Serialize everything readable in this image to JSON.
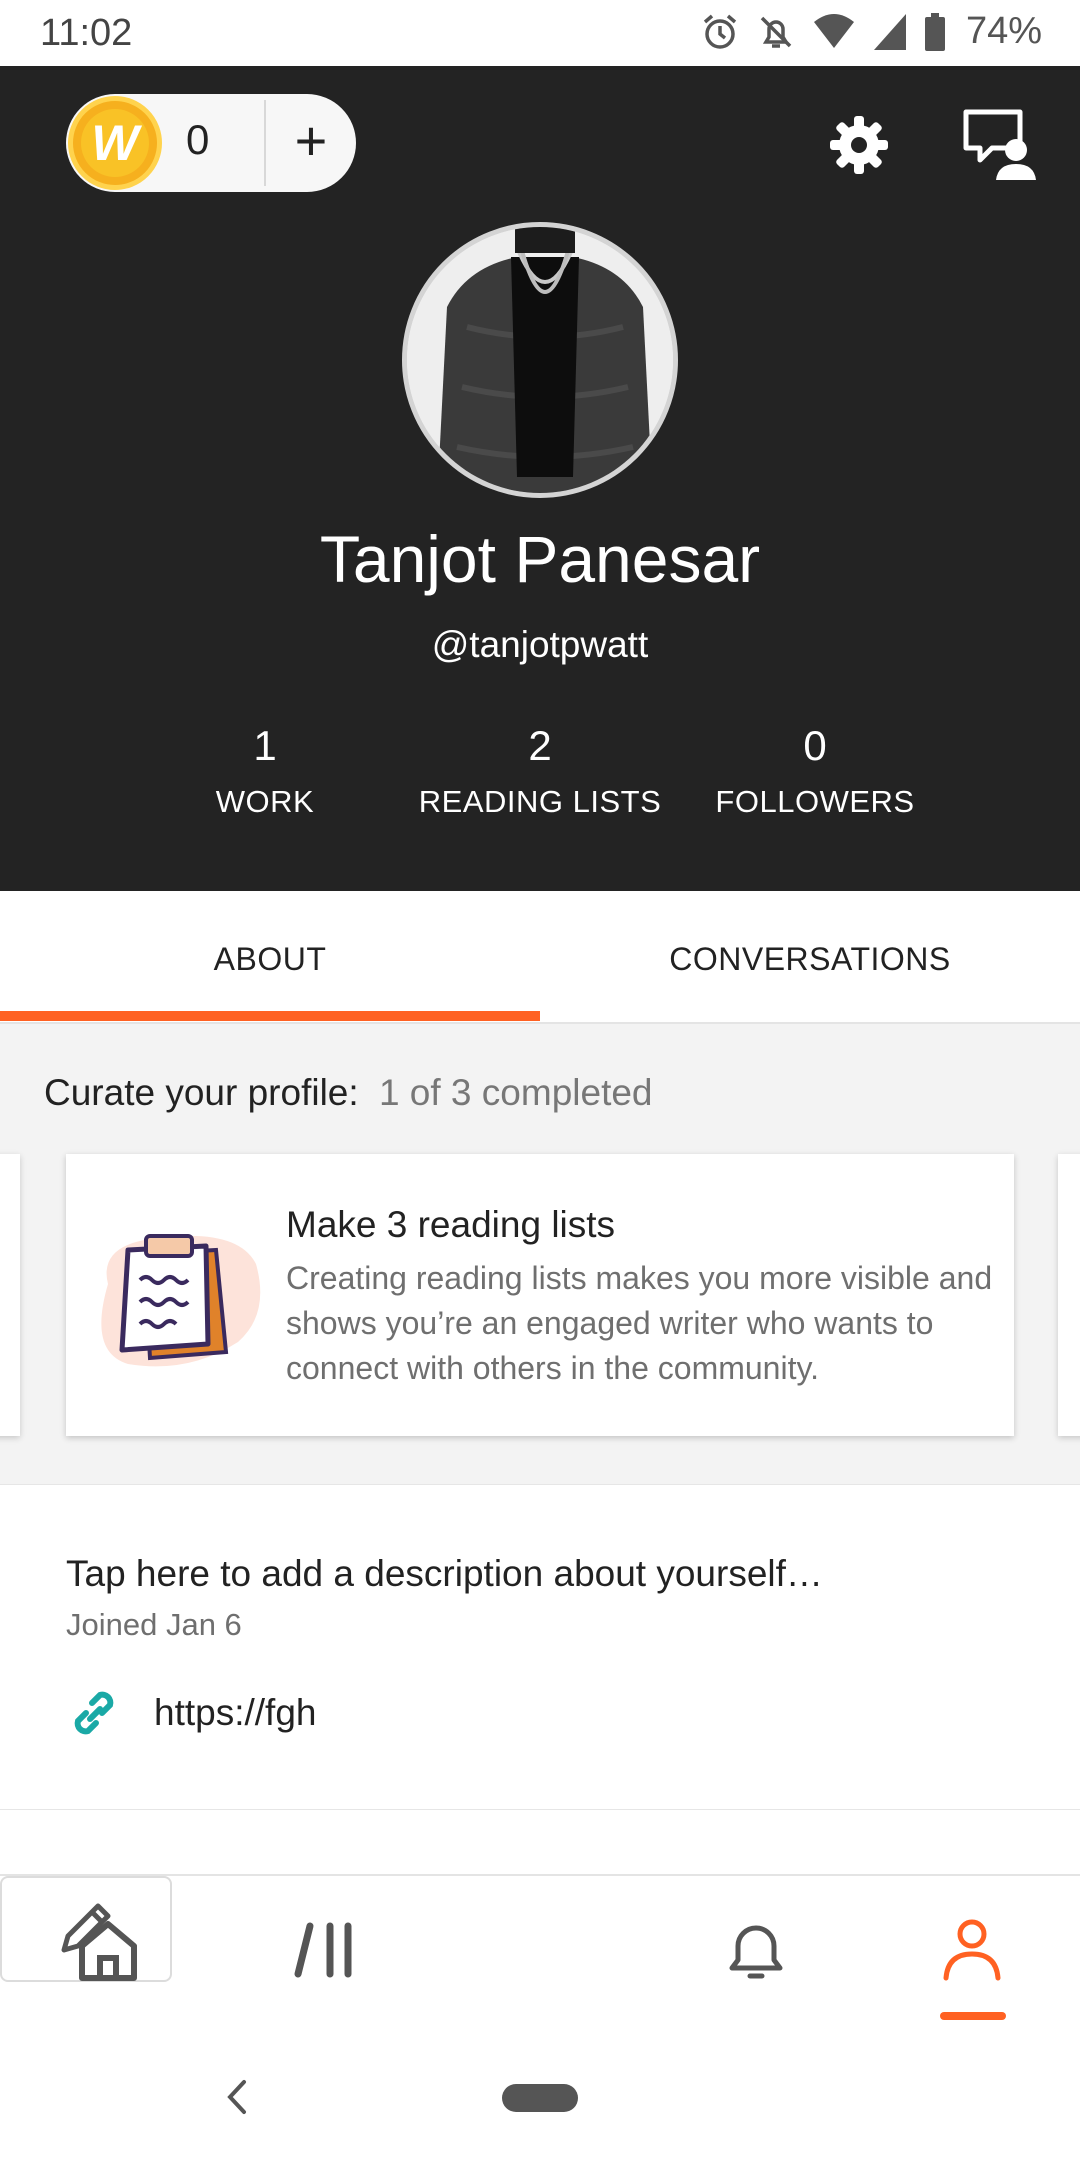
{
  "status_bar": {
    "time": "11:02",
    "battery": "74%",
    "icons": [
      "alarm-icon",
      "notifications-off-icon",
      "wifi-icon",
      "signal-icon",
      "battery-icon"
    ]
  },
  "header": {
    "coin_logo": "W",
    "coin_count": "0",
    "coin_add": "+",
    "profile_name": "Tanjot Panesar",
    "username": "@tanjotpwatt",
    "stats": {
      "work_value": "1",
      "work_label": "WORK",
      "lists_value": "2",
      "lists_label": "READING LISTS",
      "followers_value": "0",
      "followers_label": "FOLLOWERS"
    }
  },
  "tabs": {
    "about": "ABOUT",
    "conversations": "CONVERSATIONS",
    "active": "about"
  },
  "curate": {
    "label": "Curate your profile:",
    "progress": "1 of 3 completed",
    "card": {
      "title": "Make 3 reading lists",
      "description": "Creating reading lists makes you more visible and shows you’re an engaged writer who wants to connect with others in the community."
    }
  },
  "about": {
    "description_prompt": "Tap here to add a description about yourself…",
    "joined": "Joined Jan 6",
    "link": "https://fgh"
  },
  "bottom_nav": {
    "items": [
      "home-icon",
      "library-icon",
      "write-icon",
      "notifications-icon",
      "profile-icon"
    ],
    "active": "profile"
  },
  "colors": {
    "header_bg": "#232323",
    "accent": "#ff6122",
    "link_icon": "#1aa9a6",
    "coin": "#f6b01e"
  }
}
